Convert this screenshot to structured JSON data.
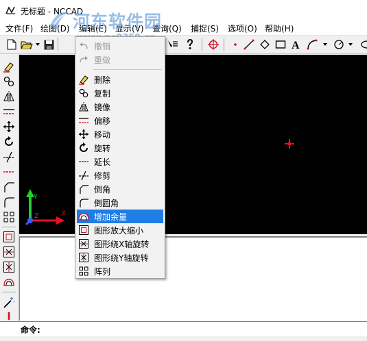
{
  "window": {
    "title": "无标题 - NCCAD"
  },
  "watermark": {
    "text": "河东软件园",
    "url": "www.pc0359.cn"
  },
  "menubar": {
    "items": [
      {
        "id": "file",
        "label": "文件(F)"
      },
      {
        "id": "draw",
        "label": "绘图(D)"
      },
      {
        "id": "edit",
        "label": "编辑(E)"
      },
      {
        "id": "view",
        "label": "显示(V)"
      },
      {
        "id": "query",
        "label": "查询(Q)"
      },
      {
        "id": "snap",
        "label": "捕捉(S)"
      },
      {
        "id": "options",
        "label": "选项(O)"
      },
      {
        "id": "help",
        "label": "帮助(H)"
      }
    ]
  },
  "edit_menu": {
    "items": [
      {
        "id": "undo",
        "label": "撤销",
        "icon": "undo-icon",
        "disabled": true
      },
      {
        "id": "redo",
        "label": "重做",
        "icon": "redo-icon",
        "disabled": true
      },
      {
        "id": "delete",
        "label": "删除",
        "icon": "eraser-icon"
      },
      {
        "id": "copy",
        "label": "复制",
        "icon": "copy-icon"
      },
      {
        "id": "mirror",
        "label": "镜像",
        "icon": "mirror-icon"
      },
      {
        "id": "offset",
        "label": "偏移",
        "icon": "offset-icon"
      },
      {
        "id": "move",
        "label": "移动",
        "icon": "move-icon"
      },
      {
        "id": "rotate",
        "label": "旋转",
        "icon": "rotate-icon"
      },
      {
        "id": "extend",
        "label": "延长",
        "icon": "extend-icon"
      },
      {
        "id": "trim",
        "label": "修剪",
        "icon": "trim-icon"
      },
      {
        "id": "chamfer",
        "label": "倒角",
        "icon": "chamfer-icon"
      },
      {
        "id": "fillet",
        "label": "倒圆角",
        "icon": "fillet-icon"
      },
      {
        "id": "allowance",
        "label": "增加余量",
        "icon": "allowance-icon",
        "highlighted": true
      },
      {
        "id": "scale",
        "label": "图形放大缩小",
        "icon": "scale-icon"
      },
      {
        "id": "rotate-x",
        "label": "图形绕X轴旋转",
        "icon": "rotate-x-icon"
      },
      {
        "id": "rotate-y",
        "label": "图形绕Y轴旋转",
        "icon": "rotate-y-icon"
      },
      {
        "id": "array",
        "label": "阵列",
        "icon": "array-icon"
      }
    ]
  },
  "canvas": {
    "axis_x_label": "X",
    "axis_y_label": "Y",
    "axis_z_label": "Z"
  },
  "command": {
    "label": "命令:",
    "value": ""
  },
  "colors": {
    "canvas_bg": "#000000",
    "highlight": "#1e7de6",
    "cursor_red": "#e8121c",
    "axis_x": "#e8121c",
    "axis_y": "#1fd12a",
    "axis_z": "#3a5cff"
  }
}
